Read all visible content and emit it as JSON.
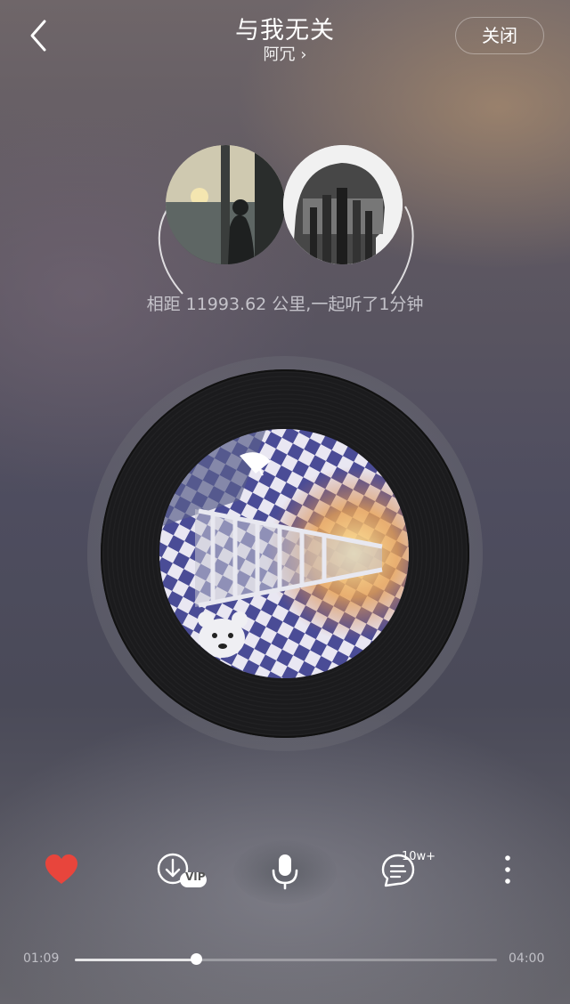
{
  "header": {
    "song_title": "与我无关",
    "artist": "阿冗 ›",
    "close_label": "关闭"
  },
  "together": {
    "distance_text": "相距 11993.62 公里,一起听了1分钟"
  },
  "controls": {
    "comment_count": "10w+",
    "download_badge": "VIP",
    "like_color": "#e8453c"
  },
  "progress": {
    "current_time": "01:09",
    "total_time": "04:00",
    "fraction": 0.2875
  },
  "icons": [
    "back-icon",
    "heart-icon",
    "download-vip-icon",
    "mic-icon",
    "comment-icon",
    "more-icon"
  ]
}
